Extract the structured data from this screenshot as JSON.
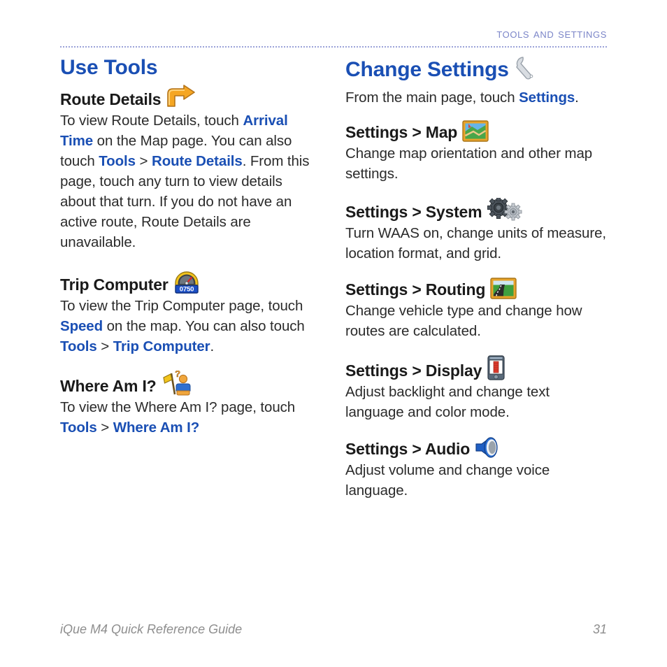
{
  "header": {
    "running_head": "Tools and Settings"
  },
  "left_column": {
    "section_title": "Use Tools",
    "blocks": [
      {
        "heading": "Route Details",
        "icon": "turn-right-arrow-icon",
        "body_parts": [
          {
            "text": "To view Route Details, touch ",
            "style": "plain"
          },
          {
            "text": "Arrival Time",
            "style": "link"
          },
          {
            "text": " on the Map page. You can also touch ",
            "style": "plain"
          },
          {
            "text": "Tools",
            "style": "link"
          },
          {
            "text": " > ",
            "style": "plain"
          },
          {
            "text": "Route Details",
            "style": "link"
          },
          {
            "text": ". From this page, touch any turn to view details about that turn. If you do not have an active route, Route Details are unavailable.",
            "style": "plain"
          }
        ]
      },
      {
        "heading": "Trip Computer",
        "icon": "speedometer-icon",
        "icon_value": "0750",
        "body_parts": [
          {
            "text": "To view the Trip Computer page, touch ",
            "style": "plain"
          },
          {
            "text": "Speed",
            "style": "link"
          },
          {
            "text": " on the map. You can also touch ",
            "style": "plain"
          },
          {
            "text": "Tools",
            "style": "link"
          },
          {
            "text": " > ",
            "style": "plain"
          },
          {
            "text": "Trip Computer",
            "style": "link"
          },
          {
            "text": ".",
            "style": "plain"
          }
        ]
      },
      {
        "heading": "Where Am I?",
        "icon": "person-with-flag-question-icon",
        "body_parts": [
          {
            "text": "To view the Where Am I? page, touch ",
            "style": "plain"
          },
          {
            "text": "Tools",
            "style": "link"
          },
          {
            "text": " > ",
            "style": "plain"
          },
          {
            "text": "Where Am I?",
            "style": "link"
          }
        ]
      }
    ]
  },
  "right_column": {
    "section_title": "Change Settings",
    "section_icon": "wrench-icon",
    "intro_parts": [
      {
        "text": "From the main page, touch ",
        "style": "plain"
      },
      {
        "text": "Settings",
        "style": "link"
      },
      {
        "text": ".",
        "style": "plain"
      }
    ],
    "blocks": [
      {
        "heading": "Settings > Map",
        "icon": "map-thumbnail-icon",
        "body": "Change map orientation and other map settings."
      },
      {
        "heading": "Settings > System",
        "icon": "gears-icon",
        "body": "Turn WAAS on, change units of measure, location format, and grid."
      },
      {
        "heading": "Settings > Routing",
        "icon": "road-icon",
        "body": "Change vehicle type and change how routes are calculated."
      },
      {
        "heading": "Settings > Display",
        "icon": "handheld-device-icon",
        "body": "Adjust backlight and change text language and color mode."
      },
      {
        "heading": "Settings > Audio",
        "icon": "speaker-icon",
        "body": "Adjust volume and change voice language."
      }
    ]
  },
  "footer": {
    "guide_title": "iQue M4 Quick Reference Guide",
    "page_number": "31"
  },
  "colors": {
    "heading_blue": "#1a4fb4",
    "link_blue": "#1a4fb4",
    "running_head": "#7b85c8",
    "body_text": "#2b2b2b",
    "footer_gray": "#8e8e8e",
    "rule": "#9aa2d8"
  }
}
